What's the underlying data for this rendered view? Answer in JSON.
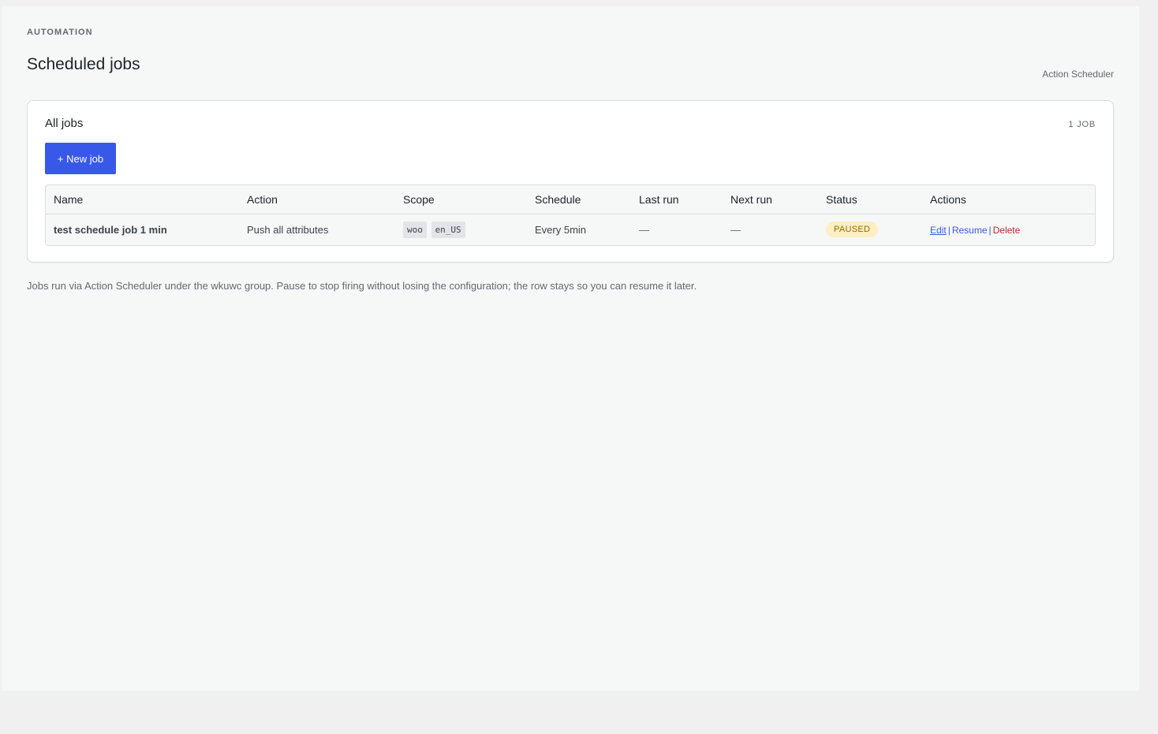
{
  "header": {
    "eyebrow": "AUTOMATION",
    "title": "Scheduled jobs",
    "link": "Action Scheduler"
  },
  "card": {
    "title": "All jobs",
    "count": "1 JOB",
    "new_button": "+ New job"
  },
  "table": {
    "columns": [
      "Name",
      "Action",
      "Scope",
      "Schedule",
      "Last run",
      "Next run",
      "Status",
      "Actions"
    ],
    "rows": [
      {
        "name": "test schedule job 1 min",
        "action": "Push all attributes",
        "scope": [
          "woo",
          "en_US"
        ],
        "schedule": "Every 5min",
        "last_run": "—",
        "next_run": "—",
        "status": "PAUSED",
        "actions": {
          "edit": "Edit",
          "separator": "|",
          "resume": "Resume",
          "delete": "Delete"
        }
      }
    ]
  },
  "footnote": "Jobs run via Action Scheduler under the wkuwc group. Pause to stop firing without losing the configuration; the row stays so you can resume it later.",
  "colors": {
    "primary": "#3858e9",
    "danger": "#b32d2e",
    "paused_bg": "#fcf0c3",
    "paused_text": "#996800"
  }
}
